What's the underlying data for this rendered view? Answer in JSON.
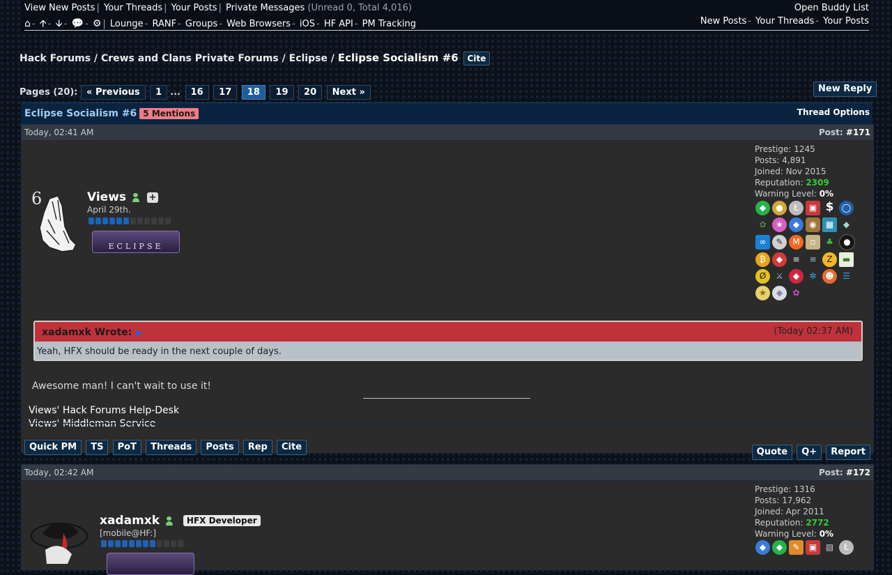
{
  "topbar": {
    "row1": [
      "View New Posts",
      "Your Threads",
      "Your Posts",
      "Private Messages"
    ],
    "pm_counts": "(Unread 0, Total 4,016)",
    "row1_right": "Open Buddy List",
    "row2_links": [
      "Lounge",
      "RANF",
      "Groups",
      "Web Browsers",
      "iOS",
      "HF API",
      "PM Tracking"
    ],
    "row2_right": [
      "New Posts",
      "Your Threads",
      "Your Posts"
    ]
  },
  "breadcrumb": {
    "items": [
      "Hack Forums",
      "Crews and Clans Private Forums",
      "Eclipse"
    ],
    "current": "Eclipse Socialism #6",
    "cite": "Cite"
  },
  "pagination": {
    "label": "Pages (20):",
    "prev": "« Previous",
    "first": "1",
    "ellipsis": "...",
    "pages": [
      "16",
      "17",
      "18",
      "19",
      "20"
    ],
    "current": "18",
    "next": "Next »"
  },
  "new_reply": "New Reply",
  "thread": {
    "title": "Eclipse Socialism #6",
    "mentions": "5 Mentions",
    "options": "Thread Options"
  },
  "posts": [
    {
      "date": "Today, 02:41 AM",
      "post_label": "Post:",
      "post_no": "#171",
      "username": "Views",
      "user_title": "April 29th.",
      "rank_level": 6,
      "prestige": "Prestige: 1245",
      "posts": "Posts: 4,891",
      "joined": "Joined: Nov 2015",
      "rep_label": "Reputation:",
      "rep": "2309",
      "warn_label": "Warning Level:",
      "warn": "0%",
      "avatar_digit": "6",
      "group_badge": "ECLIPSE",
      "quote_author": "xadamxk Wrote:",
      "quote_time": "(Today 02:37 AM)",
      "quote_text": "Yeah, HFX should be ready in the next couple of days.",
      "message": "Awesome man! I can't wait to use it!",
      "signature": [
        "Views' Hack Forums Help-Desk",
        "Views' Middleman Service"
      ],
      "actions": [
        "Quick PM",
        "TS",
        "PoT",
        "Threads",
        "Posts",
        "Rep",
        "Cite"
      ],
      "actions_right": [
        "Quote",
        "Q+",
        "Report"
      ]
    },
    {
      "date": "Today, 02:42 AM",
      "post_label": "Post:",
      "post_no": "#172",
      "username": "xadamxk",
      "badge": "HFX Developer",
      "user_title": "[mobile@HF:]",
      "rank_level": 8,
      "prestige": "Prestige: 1316",
      "posts": "Posts: 17,962",
      "joined": "Joined: Apr 2011",
      "rep_label": "Reputation:",
      "rep": "2772",
      "warn_label": "Warning Level:",
      "warn": "0%"
    }
  ]
}
